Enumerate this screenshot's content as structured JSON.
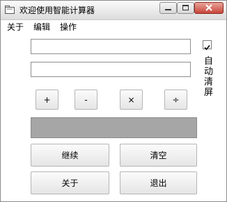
{
  "window": {
    "title": "欢迎使用智能计算器",
    "controls": {
      "minimize_icon": "minimize-icon",
      "maximize_icon": "maximize-icon",
      "close_icon": "close-icon"
    }
  },
  "menu": {
    "items": [
      {
        "label": "关于"
      },
      {
        "label": "编辑"
      },
      {
        "label": "操作"
      }
    ]
  },
  "inputs": {
    "first": {
      "value": ""
    },
    "second": {
      "value": ""
    }
  },
  "auto_clear": {
    "checked": true,
    "label_chars": [
      "自",
      "动",
      "清",
      "屏"
    ]
  },
  "operators": [
    {
      "label": "+"
    },
    {
      "label": "-"
    },
    {
      "label": "×"
    },
    {
      "label": "÷"
    }
  ],
  "result": {
    "value": ""
  },
  "actions": {
    "continue_label": "继续",
    "clear_label": "清空",
    "about_label": "关于",
    "exit_label": "退出"
  }
}
